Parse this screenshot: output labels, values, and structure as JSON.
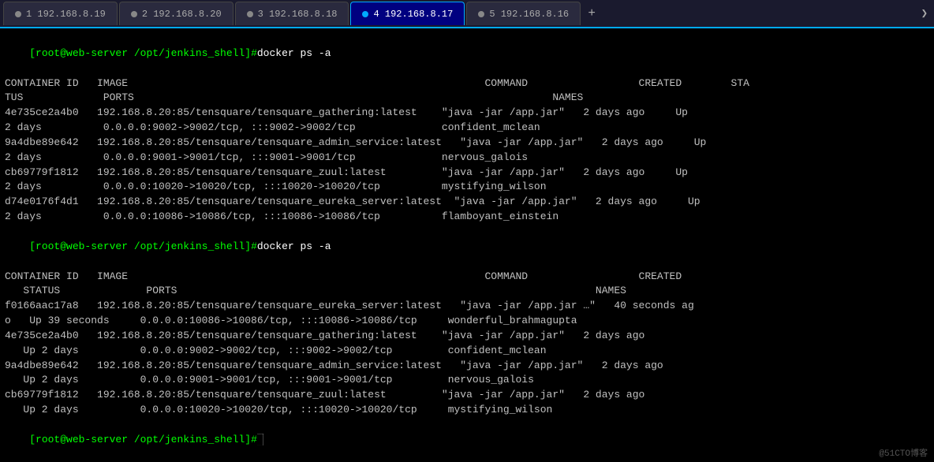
{
  "tabs": [
    {
      "id": 1,
      "label": "192.168.8.19",
      "active": false,
      "dot_color": "#888"
    },
    {
      "id": 2,
      "label": "192.168.8.20",
      "active": false,
      "dot_color": "#888"
    },
    {
      "id": 3,
      "label": "192.168.8.18",
      "active": false,
      "dot_color": "#888"
    },
    {
      "id": 4,
      "label": "192.168.8.17",
      "active": true,
      "dot_color": "#00aaff"
    },
    {
      "id": 5,
      "label": "192.168.8.16",
      "active": false,
      "dot_color": "#888"
    }
  ],
  "terminal_lines": [
    {
      "type": "prompt",
      "text": "[root@web-server /opt/jenkins_shell]#docker ps -a"
    },
    {
      "type": "header",
      "text": "CONTAINER ID   IMAGE                                                          COMMAND                  CREATED        STA"
    },
    {
      "type": "header",
      "text": "TUS             PORTS                                                                    NAMES"
    },
    {
      "type": "normal",
      "text": "4e735ce2a4b0   192.168.8.20:85/tensquare/tensquare_gathering:latest    \"java -jar /app.jar\"   2 days ago     Up"
    },
    {
      "type": "normal",
      "text": "2 days          0.0.0.0:9002->9002/tcp, :::9002->9002/tcp              confident_mclean"
    },
    {
      "type": "normal",
      "text": "9a4dbe89e642   192.168.8.20:85/tensquare/tensquare_admin_service:latest   \"java -jar /app.jar\"   2 days ago     Up"
    },
    {
      "type": "normal",
      "text": "2 days          0.0.0.0:9001->9001/tcp, :::9001->9001/tcp              nervous_galois"
    },
    {
      "type": "normal",
      "text": "cb69779f1812   192.168.8.20:85/tensquare/tensquare_zuul:latest         \"java -jar /app.jar\"   2 days ago     Up"
    },
    {
      "type": "normal",
      "text": "2 days          0.0.0.0:10020->10020/tcp, :::10020->10020/tcp          mystifying_wilson"
    },
    {
      "type": "normal",
      "text": "d74e0176f4d1   192.168.8.20:85/tensquare/tensquare_eureka_server:latest  \"java -jar /app.jar\"   2 days ago     Up"
    },
    {
      "type": "normal",
      "text": "2 days          0.0.0.0:10086->10086/tcp, :::10086->10086/tcp          flamboyant_einstein"
    },
    {
      "type": "prompt",
      "text": "[root@web-server /opt/jenkins_shell]#docker ps -a"
    },
    {
      "type": "header",
      "text": "CONTAINER ID   IMAGE                                                          COMMAND                  CREATED"
    },
    {
      "type": "header",
      "text": "   STATUS              PORTS                                                                    NAMES"
    },
    {
      "type": "normal",
      "text": "f0166aac17a8   192.168.8.20:85/tensquare/tensquare_eureka_server:latest   \"java -jar /app.jar …\"   40 seconds ag"
    },
    {
      "type": "normal",
      "text": "o   Up 39 seconds     0.0.0.0:10086->10086/tcp, :::10086->10086/tcp     wonderful_brahmagupta"
    },
    {
      "type": "normal",
      "text": "4e735ce2a4b0   192.168.8.20:85/tensquare/tensquare_gathering:latest    \"java -jar /app.jar\"   2 days ago"
    },
    {
      "type": "normal",
      "text": "   Up 2 days          0.0.0.0:9002->9002/tcp, :::9002->9002/tcp         confident_mclean"
    },
    {
      "type": "normal",
      "text": "9a4dbe89e642   192.168.8.20:85/tensquare/tensquare_admin_service:latest   \"java -jar /app.jar\"   2 days ago"
    },
    {
      "type": "normal",
      "text": "   Up 2 days          0.0.0.0:9001->9001/tcp, :::9001->9001/tcp         nervous_galois"
    },
    {
      "type": "normal",
      "text": "cb69779f1812   192.168.8.20:85/tensquare/tensquare_zuul:latest         \"java -jar /app.jar\"   2 days ago"
    },
    {
      "type": "normal",
      "text": "   Up 2 days          0.0.0.0:10020->10020/tcp, :::10020->10020/tcp     mystifying_wilson"
    },
    {
      "type": "prompt_only",
      "text": "[root@web-server /opt/jenkins_shell]#"
    }
  ],
  "watermark": "@51CTO博客"
}
